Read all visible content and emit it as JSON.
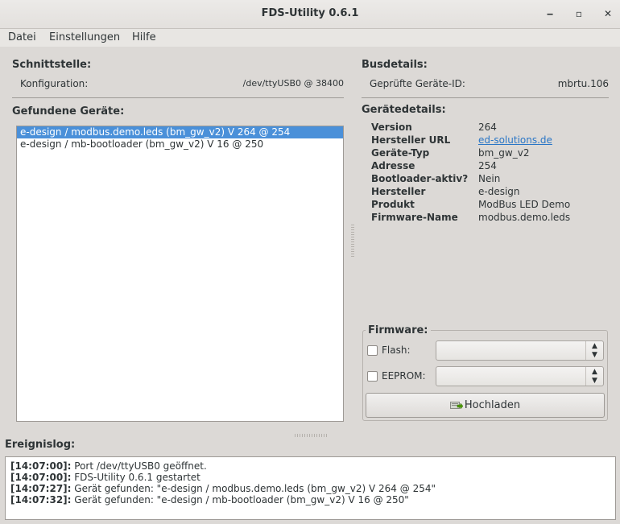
{
  "window": {
    "title": "FDS-Utility 0.6.1",
    "minimize_glyph": "‒",
    "maximize_glyph": "▫",
    "close_glyph": "✕"
  },
  "menu": [
    "Datei",
    "Einstellungen",
    "Hilfe"
  ],
  "schnittstelle": {
    "heading": "Schnittstelle:",
    "config_label": "Konfiguration:",
    "config_value": "/dev/ttyUSB0 @ 38400"
  },
  "geraete": {
    "heading": "Gefundene Geräte:",
    "items": [
      {
        "label": "e-design / modbus.demo.leds (bm_gw_v2) V 264 @ 254",
        "selected": true
      },
      {
        "label": "e-design / mb-bootloader (bm_gw_v2) V 16 @ 250",
        "selected": false
      }
    ]
  },
  "busdetails": {
    "heading": "Busdetails:",
    "id_label": "Geprüfte Geräte-ID:",
    "id_value": "mbrtu.106"
  },
  "geraetedetails": {
    "heading": "Gerätedetails:",
    "rows": [
      {
        "key": "Version",
        "value": "264"
      },
      {
        "key": "Hersteller URL",
        "value": "ed-solutions.de",
        "link": true
      },
      {
        "key": "Geräte-Typ",
        "value": "bm_gw_v2"
      },
      {
        "key": "Adresse",
        "value": "254"
      },
      {
        "key": "Bootloader-aktiv?",
        "value": "Nein"
      },
      {
        "key": "Hersteller",
        "value": "e-design"
      },
      {
        "key": "Produkt",
        "value": "ModBus LED Demo"
      },
      {
        "key": "Firmware-Name",
        "value": "modbus.demo.leds"
      }
    ]
  },
  "firmware": {
    "heading": "Firmware:",
    "flash_label": "Flash:",
    "flash_checked": false,
    "flash_selected": "",
    "eeprom_label": "EEPROM:",
    "eeprom_checked": false,
    "eeprom_selected": "",
    "upload_label": "Hochladen",
    "upload_icon": "upload-icon"
  },
  "log": {
    "heading": "Ereignislog:",
    "entries": [
      {
        "time": "[14:07:00]:",
        "text": " Port /dev/ttyUSB0 geöffnet."
      },
      {
        "time": "[14:07:00]:",
        "text": " FDS-Utility 0.6.1 gestartet"
      },
      {
        "time": "[14:07:27]:",
        "text": " Gerät gefunden: \"e-design / modbus.demo.leds (bm_gw_v2) V 264 @ 254\""
      },
      {
        "time": "[14:07:32]:",
        "text": " Gerät gefunden: \"e-design / mb-bootloader (bm_gw_v2) V 16 @ 250\""
      }
    ]
  },
  "colors": {
    "selection": "#4a90d9",
    "link": "#2a76c6",
    "background": "#dcd9d6"
  }
}
